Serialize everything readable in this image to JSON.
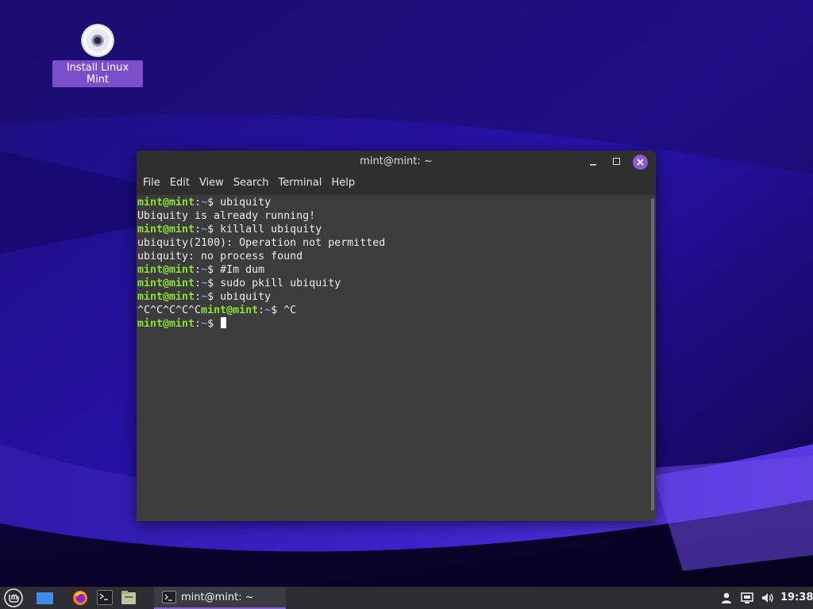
{
  "desktop": {
    "icons": [
      {
        "label": "Install Linux Mint",
        "icon": "disc-icon"
      }
    ]
  },
  "terminal_window": {
    "title": "mint@mint: ~",
    "menu": [
      "File",
      "Edit",
      "View",
      "Search",
      "Terminal",
      "Help"
    ],
    "prompt": {
      "user": "mint@mint",
      "path": "~",
      "symbol": "$"
    },
    "lines": [
      {
        "type": "prompt",
        "cmd": " ubiquity"
      },
      {
        "type": "output",
        "text": "Ubiquity is already running!"
      },
      {
        "type": "prompt",
        "cmd": " killall ubiquity"
      },
      {
        "type": "output",
        "text": "ubiquity(2100): Operation not permitted"
      },
      {
        "type": "output",
        "text": "ubiquity: no process found"
      },
      {
        "type": "prompt",
        "cmd": " #Im dum"
      },
      {
        "type": "prompt",
        "cmd": " sudo pkill ubiquity"
      },
      {
        "type": "prompt",
        "cmd": " ubiquity"
      },
      {
        "type": "prompt",
        "pre": "^C^C^C^C^C",
        "cmd": " ^C"
      },
      {
        "type": "prompt",
        "cmd": " ",
        "cursor": true
      }
    ]
  },
  "taskbar": {
    "launchers": [
      "mint-menu-icon",
      "show-desktop-icon",
      "firefox-icon",
      "terminal-icon",
      "files-icon"
    ],
    "task_label": "mint@mint: ~",
    "tray_icons": [
      "user-icon",
      "network-icon",
      "volume-icon"
    ],
    "clock": "19:38"
  },
  "colors": {
    "prompt_user": "#8ae234",
    "prompt_path": "#729fcf",
    "accent": "#8c5cd6",
    "terminal_bg": "#3c3c3c"
  }
}
